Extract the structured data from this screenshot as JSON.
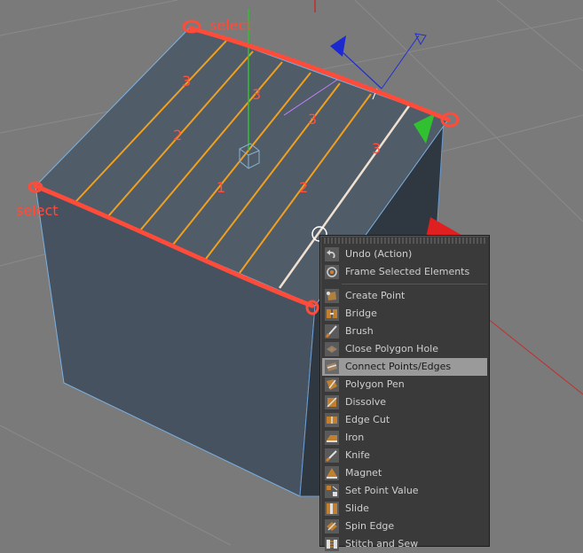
{
  "viewport": {
    "annotations": {
      "select_label_top": "select",
      "select_label_left": "select",
      "numbers": [
        "3",
        "3",
        "2",
        "3",
        "3",
        "1",
        "2"
      ]
    }
  },
  "context_menu": {
    "items_group1": [
      {
        "label": "Undo (Action)",
        "icon": "undo-icon"
      },
      {
        "label": "Frame Selected Elements",
        "icon": "frame-icon"
      }
    ],
    "items_group2": [
      {
        "label": "Create Point",
        "icon": "create-point-icon"
      },
      {
        "label": "Bridge",
        "icon": "bridge-icon"
      },
      {
        "label": "Brush",
        "icon": "brush-icon"
      },
      {
        "label": "Close Polygon Hole",
        "icon": "close-hole-icon"
      },
      {
        "label": "Connect Points/Edges",
        "icon": "connect-icon",
        "highlighted": true
      },
      {
        "label": "Polygon Pen",
        "icon": "polygon-pen-icon"
      },
      {
        "label": "Dissolve",
        "icon": "dissolve-icon"
      },
      {
        "label": "Edge Cut",
        "icon": "edge-cut-icon"
      },
      {
        "label": "Iron",
        "icon": "iron-icon"
      },
      {
        "label": "Knife",
        "icon": "knife-icon"
      },
      {
        "label": "Magnet",
        "icon": "magnet-icon"
      },
      {
        "label": "Set Point Value",
        "icon": "set-point-value-icon"
      },
      {
        "label": "Slide",
        "icon": "slide-icon"
      },
      {
        "label": "Spin Edge",
        "icon": "spin-edge-icon"
      },
      {
        "label": "Stitch and Sew",
        "icon": "stitch-icon"
      }
    ]
  },
  "colors": {
    "background": "#7a7a7a",
    "cube_face": "#45505c",
    "edge_selected": "#f0a020",
    "annotation": "#ff4b3a",
    "menu_bg": "#3a3a3a",
    "menu_highlight": "#9a9a9a"
  }
}
